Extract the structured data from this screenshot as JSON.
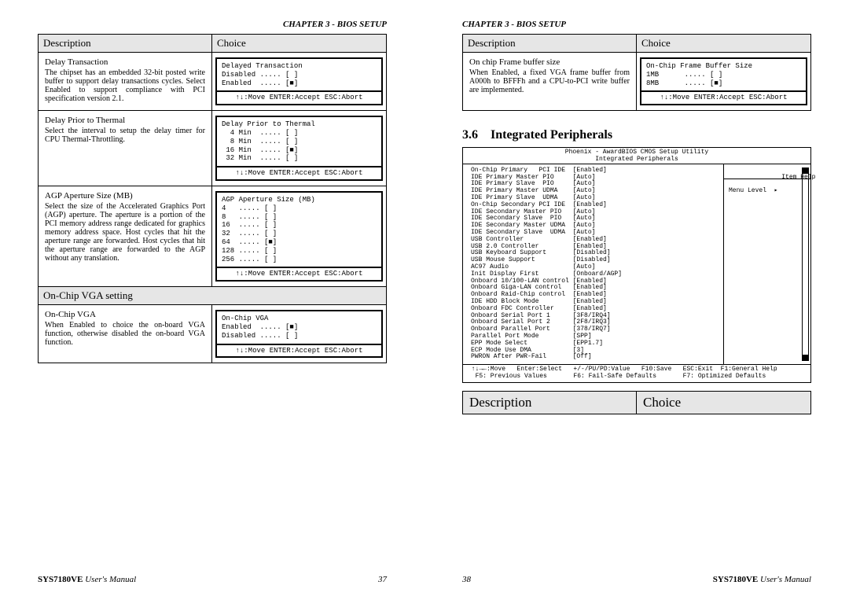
{
  "chapter": "CHAPTER 3 - BIOS SETUP",
  "manual": "SYS7180VE",
  "manual_suffix": "User's Manual",
  "leftPageNum": "37",
  "rightPageNum": "38",
  "headers": {
    "desc": "Description",
    "choice": "Choice"
  },
  "biosFooter": "↑↓:Move ENTER:Accept ESC:Abort",
  "leftRows": [
    {
      "title": "Delay Transaction",
      "body": "The chipset has an embedded 32-bit posted write buffer to support delay transactions cycles. Select Enabled to support compliance with PCI specification version 2.1.",
      "box": "Delayed Transaction\nDisabled ..... [ ]\nEnabled  ..... [■]"
    },
    {
      "title": "Delay Prior to Thermal",
      "body": "Select the interval to setup the delay timer for CPU Thermal-Throttling.",
      "box": "Delay Prior to Thermal\n  4 Min  ..... [ ]\n  8 Min  ..... [ ]\n 16 Min  ..... [■]\n 32 Min  ..... [ ]"
    },
    {
      "title": "AGP Aperture Size (MB)",
      "body": "Select the size of the Accelerated Graphics Port (AGP) aperture. The aperture is a portion of the PCI memory address range dedicated for graphics memory address space. Host cycles that hit the aperture range are forwarded. Host cycles that hit the aperture range are forwarded to the AGP without any translation.",
      "box": "AGP Aperture Size (MB)\n4   ..... [ ]\n8   ..... [ ]\n16  ..... [ ]\n32  ..... [ ]\n64  ..... [■]\n128 ..... [ ]\n256 ..... [ ]"
    }
  ],
  "subheader": "On-Chip VGA setting",
  "leftSubRow": {
    "title": "On-Chip VGA",
    "body": "When Enabled to choice the on-board VGA function, otherwise disabled the on-board VGA function.",
    "box": "On-Chip VGA\nEnabled  ..... [■]\nDisabled ..... [ ]"
  },
  "rightRow": {
    "title": "On chip Frame buffer size",
    "body": "When Enabled, a fixed VGA frame buffer from A000h to BFFFh and a CPU-to-PCI write buffer are implemented.",
    "box": "On-Chip Frame Buffer Size\n1MB      ..... [ ]\n8MB      ..... [■]"
  },
  "section": {
    "num": "3.6",
    "title": "Integrated Peripherals"
  },
  "cmos": {
    "title": "Phoenix - AwardBIOS CMOS Setup Utility\nIntegrated Peripherals",
    "left": "On-Chip Primary   PCI IDE  [Enabled]\nIDE Primary Master PIO     [Auto]\nIDE Primary Slave  PIO     [Auto]\nIDE Primary Master UDMA    [Auto]\nIDE Primary Slave  UDMA    [Auto]\nOn-Chip Secondary PCI IDE  [Enabled]\nIDE Secondary Master PIO   [Auto]\nIDE Secondary Slave  PIO   [Auto]\nIDE Secondary Master UDMA  [Auto]\nIDE Secondary Slave  UDMA  [Auto]\nUSB Controller             [Enabled]\nUSB 2.0 Controller         [Enabled]\nUSB Keyboard Support       [Disabled]\nUSB Mouse Support          [Disabled]\nAC97 Audio                 [Auto]\nInit Display First         [Onboard/AGP]\nOnboard 10/100-LAN control [Enabled]\nOnboard Giga-LAN control   [Enabled]\nOnboard Raid-Chip control  [Enabled]\nIDE HDD Block Mode         [Enabled]\nOnboard FDC Controller     [Enabled]\nOnboard Serial Port 1      [3F8/IRQ4]\nOnboard Serial Port 2      [2F8/IRQ3]\nOnboard Parallel Port      [378/IRQ7]\nParallel Port Mode         [SPP]\nEPP Mode Select            [EPP1.7]\nECP Mode Use DMA           [3]\nPWRON After PWR-Fail       [Off]",
    "right": "    Item Help\n\nMenu Level  ▸",
    "foot": " ↑↓→←:Move   Enter:Select   +/-/PU/PD:Value   F10:Save   ESC:Exit  F1:General Help\n  F5: Previous Values       F6: Fail-Safe Defaults       F7: Optimized Defaults"
  }
}
